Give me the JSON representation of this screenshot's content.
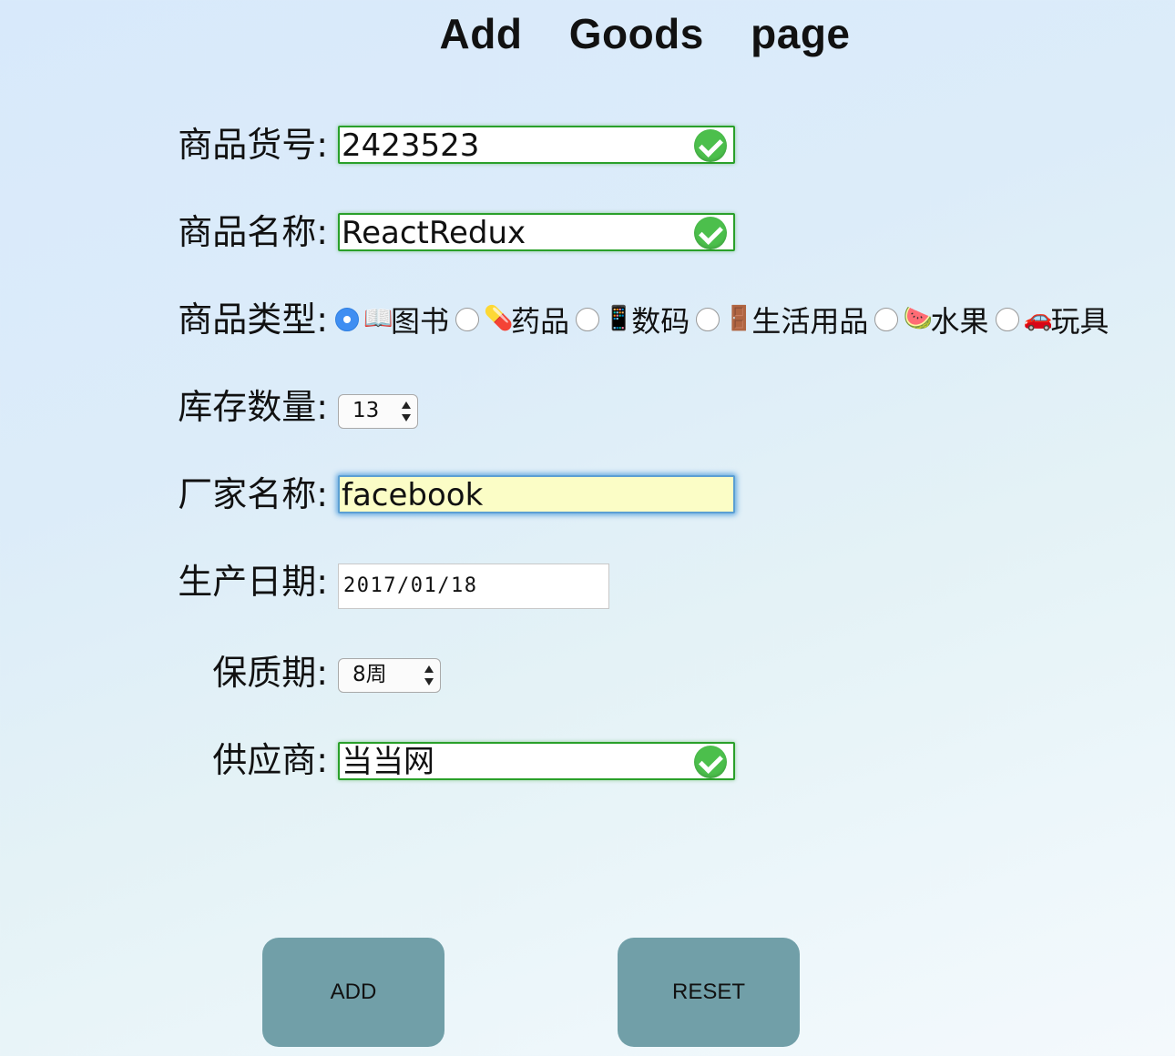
{
  "page": {
    "title": "Add Goods page"
  },
  "form": {
    "goods_no": {
      "label": "商品货号:",
      "value": "2423523",
      "valid": true
    },
    "goods_name": {
      "label": "商品名称:",
      "value": "ReactRedux",
      "valid": true
    },
    "goods_type": {
      "label": "商品类型:",
      "selected": "图书",
      "options": [
        {
          "icon": "📖",
          "icon_name": "book-icon",
          "label": "图书",
          "checked": true
        },
        {
          "icon": "💊",
          "icon_name": "pill-icon",
          "label": "药品",
          "checked": false
        },
        {
          "icon": "📱",
          "icon_name": "phone-icon",
          "label": "数码",
          "checked": false
        },
        {
          "icon": "🚪",
          "icon_name": "door-icon",
          "label": "生活用品",
          "checked": false
        },
        {
          "icon": "🍉",
          "icon_name": "watermelon-icon",
          "label": "水果",
          "checked": false
        },
        {
          "icon": "🚗",
          "icon_name": "car-icon",
          "label": "玩具",
          "checked": false
        }
      ]
    },
    "stock_quantity": {
      "label": "库存数量:",
      "value": "13"
    },
    "manufacturer": {
      "label": "厂家名称:",
      "value": "facebook",
      "focused": true,
      "autofill_color": "#fbfdc6"
    },
    "production_date": {
      "label": "生产日期:",
      "value": "2017/01/18"
    },
    "shelf_life": {
      "label": "保质期:",
      "value": "8周"
    },
    "supplier": {
      "label": "供应商:",
      "value": "当当网",
      "valid": true
    }
  },
  "actions": {
    "add_label": "ADD",
    "reset_label": "RESET",
    "button_color": "#719fa8"
  },
  "colors": {
    "valid_border": "#2aa02a",
    "valid_icon": "#4cbf4c",
    "focus_border": "#5b9fd3",
    "radio_checked": "#3f8ef2"
  }
}
